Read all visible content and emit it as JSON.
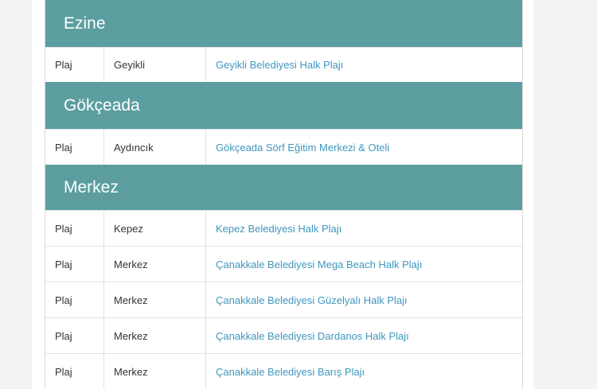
{
  "groups": [
    {
      "title": "Ezine",
      "rows": [
        {
          "type": "Plaj",
          "location": "Geyikli",
          "name": "Geyikli Belediyesi Halk Plajı"
        }
      ]
    },
    {
      "title": "Gökçeada",
      "rows": [
        {
          "type": "Plaj",
          "location": "Aydıncık",
          "name": "Gökçeada Sörf Eğitim Merkezi & Oteli"
        }
      ]
    },
    {
      "title": "Merkez",
      "rows": [
        {
          "type": "Plaj",
          "location": "Kepez",
          "name": "Kepez Belediyesi Halk Plajı"
        },
        {
          "type": "Plaj",
          "location": "Merkez",
          "name": "Çanakkale Belediyesi Mega Beach Halk Plajı"
        },
        {
          "type": "Plaj",
          "location": "Merkez",
          "name": "Çanakkale Belediyesi Güzelyalı Halk Plajı"
        },
        {
          "type": "Plaj",
          "location": "Merkez",
          "name": "Çanakkale Belediyesi Dardanos Halk Plajı"
        },
        {
          "type": "Plaj",
          "location": "Merkez",
          "name": "Çanakkale Belediyesi Barış Plajı"
        }
      ]
    }
  ]
}
